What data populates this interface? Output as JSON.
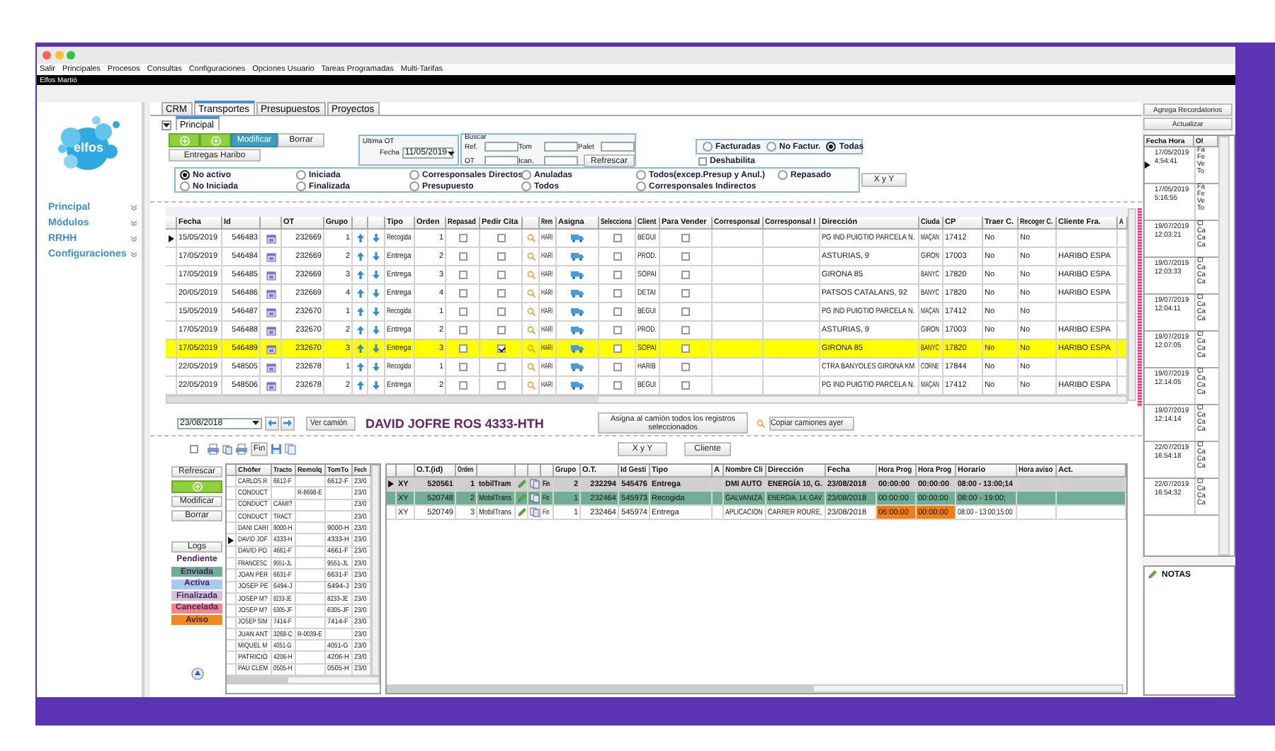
{
  "menu": [
    "Salir",
    "Principales",
    "Procesos",
    "Consultas",
    "Configuraciones",
    "Opciones Usuario",
    "Tareas Programadas",
    "Multi-Tarifas"
  ],
  "company": "Elfos Martió",
  "sidebar": {
    "logo": "elfos",
    "items": [
      {
        "label": "Principal"
      },
      {
        "label": "Módulos"
      },
      {
        "label": "RRHH"
      },
      {
        "label": "Configuraciones"
      }
    ]
  },
  "tabs": [
    {
      "label": "CRM",
      "selected": false
    },
    {
      "label": "Transportes",
      "selected": true
    },
    {
      "label": "Presupuestos",
      "selected": false
    },
    {
      "label": "Proyectos",
      "selected": false
    }
  ],
  "subtabs": [
    {
      "label": "Principal",
      "selected": true
    }
  ],
  "actions": [
    {
      "kind": "add"
    },
    {
      "kind": "add"
    },
    {
      "kind": "primary",
      "label": "Modificar"
    },
    {
      "kind": "plain",
      "label": "Borrar"
    }
  ],
  "secondary_action": "Entregas Haribo",
  "last_ot": {
    "title": "Ultima OT",
    "date_label": "Fecha",
    "date": "11/05/2019"
  },
  "search": {
    "title": "Buscar",
    "fields": [
      {
        "label": "Ref."
      },
      {
        "label": "Tom"
      },
      {
        "label": "Palet"
      },
      {
        "label": "OT"
      },
      {
        "label": "Ican."
      }
    ],
    "button": "Refrescar"
  },
  "billing_filter": [
    {
      "label": "Facturadas",
      "selected": false
    },
    {
      "label": "No Factur.",
      "selected": false
    },
    {
      "label": "Todas",
      "selected": true
    }
  ],
  "disable_checkbox": {
    "label": "Deshabilita",
    "checked": false
  },
  "state_filter": [
    {
      "label": "No activo",
      "selected": true
    },
    {
      "label": "Iniciada",
      "selected": false
    },
    {
      "label": "Corresponsales Directos",
      "selected": false
    },
    {
      "label": "Anuladas",
      "selected": false
    },
    {
      "label": "Todos(excep.Presup y Anul.)",
      "selected": false
    },
    {
      "label": "Repasado",
      "selected": false
    },
    {
      "label": "No Iniciada",
      "selected": false
    },
    {
      "label": "Finalizada",
      "selected": false
    },
    {
      "label": "Presupuesto",
      "selected": false
    },
    {
      "label": "Todos",
      "selected": false
    },
    {
      "label": "Corresponsales Indirectos",
      "selected": false
    }
  ],
  "xy_button": "X y Y",
  "orders": {
    "columns": [
      "Fecha",
      "Id",
      "OT",
      "Grupo",
      "Tipo",
      "Orden",
      "Repasad",
      "Pedir Cita",
      "Rem",
      "Asigna",
      "Selecciona",
      "Client",
      "Para Vender",
      "Corresponsal",
      "Corresponsal I",
      "Dirección",
      "Ciuda",
      "CP",
      "Traer C.",
      "Recoger C.",
      "Cliente Fra.",
      "A"
    ],
    "rows": [
      {
        "fecha": "15/05/2019",
        "id": "546483",
        "ot": "232669",
        "grupo": "1",
        "tipo": "Recogida",
        "orden": "1",
        "repasado": false,
        "pedir_cita": false,
        "rem": "HARI",
        "seleccion": false,
        "cliente": "BEGUI",
        "para_vender": false,
        "direccion": "PG IND PUIGTIO PARCELA N.",
        "ciudad": "MAÇAN",
        "cp": "17412",
        "traer": "No",
        "recoger": "No",
        "cliente_fra": "",
        "current": true,
        "selected": false
      },
      {
        "fecha": "17/05/2019",
        "id": "546484",
        "ot": "232669",
        "grupo": "2",
        "tipo": "Entrega",
        "orden": "2",
        "repasado": false,
        "pedir_cita": false,
        "rem": "HARI",
        "seleccion": false,
        "cliente": "PROD.",
        "para_vender": false,
        "direccion": "ASTURIAS, 9",
        "ciudad": "GIRON",
        "cp": "17003",
        "traer": "No",
        "recoger": "No",
        "cliente_fra": "HARIBO ESPA",
        "current": false,
        "selected": false
      },
      {
        "fecha": "17/05/2019",
        "id": "546485",
        "ot": "232669",
        "grupo": "3",
        "tipo": "Entrega",
        "orden": "3",
        "repasado": false,
        "pedir_cita": false,
        "rem": "HARI",
        "seleccion": false,
        "cliente": "SOPAI",
        "para_vender": false,
        "direccion": "GIRONA 85",
        "ciudad": "BANYC",
        "cp": "17820",
        "traer": "No",
        "recoger": "No",
        "cliente_fra": "HARIBO ESPA",
        "current": false,
        "selected": false
      },
      {
        "fecha": "20/05/2019",
        "id": "546486",
        "ot": "232669",
        "grupo": "4",
        "tipo": "Entrega",
        "orden": "4",
        "repasado": false,
        "pedir_cita": false,
        "rem": "HARI",
        "seleccion": false,
        "cliente": "DETAI",
        "para_vender": false,
        "direccion": "PATSOS CATALANS, 92",
        "ciudad": "BANYC",
        "cp": "17820",
        "traer": "No",
        "recoger": "No",
        "cliente_fra": "HARIBO ESPA",
        "current": false,
        "selected": false
      },
      {
        "fecha": "15/05/2019",
        "id": "546487",
        "ot": "232670",
        "grupo": "1",
        "tipo": "Recogida",
        "orden": "1",
        "repasado": false,
        "pedir_cita": false,
        "rem": "HARI",
        "seleccion": false,
        "cliente": "BEGUI",
        "para_vender": false,
        "direccion": "PG IND PUIGTIO PARCELA N.",
        "ciudad": "MAÇAN",
        "cp": "17412",
        "traer": "No",
        "recoger": "No",
        "cliente_fra": "",
        "current": false,
        "selected": false
      },
      {
        "fecha": "17/05/2019",
        "id": "546488",
        "ot": "232670",
        "grupo": "2",
        "tipo": "Entrega",
        "orden": "2",
        "repasado": false,
        "pedir_cita": false,
        "rem": "HARI",
        "seleccion": false,
        "cliente": "PROD.",
        "para_vender": false,
        "direccion": "ASTURIAS, 9",
        "ciudad": "GIRON",
        "cp": "17003",
        "traer": "No",
        "recoger": "No",
        "cliente_fra": "HARIBO ESPA",
        "current": false,
        "selected": false
      },
      {
        "fecha": "17/05/2019",
        "id": "546489",
        "ot": "232670",
        "grupo": "3",
        "tipo": "Entrega",
        "orden": "3",
        "repasado": false,
        "pedir_cita": true,
        "rem": "HARI",
        "seleccion": false,
        "cliente": "SOPAI",
        "para_vender": false,
        "direccion": "GIRONA 85",
        "ciudad": "BANYC",
        "cp": "17820",
        "traer": "No",
        "recoger": "No",
        "cliente_fra": "HARIBO ESPA",
        "current": false,
        "selected": true
      },
      {
        "fecha": "22/05/2019",
        "id": "548505",
        "ot": "232678",
        "grupo": "1",
        "tipo": "Recogida",
        "orden": "1",
        "repasado": false,
        "pedir_cita": false,
        "rem": "HARI",
        "seleccion": false,
        "cliente": "HARIB",
        "para_vender": false,
        "direccion": "CTRA BANYOLES GIRONA KM",
        "ciudad": "CORNE",
        "cp": "17844",
        "traer": "No",
        "recoger": "No",
        "cliente_fra": "",
        "current": false,
        "selected": false
      },
      {
        "fecha": "22/05/2019",
        "id": "548506",
        "ot": "232678",
        "grupo": "2",
        "tipo": "Entrega",
        "orden": "2",
        "repasado": false,
        "pedir_cita": false,
        "rem": "HARI",
        "seleccion": false,
        "cliente": "BEGUI",
        "para_vender": false,
        "direccion": "PG IND PUIGTIO PARCELA N.",
        "ciudad": "MAÇAN",
        "cp": "17412",
        "traer": "No",
        "recoger": "No",
        "cliente_fra": "HARIBO ESPA",
        "current": false,
        "selected": false
      }
    ]
  },
  "truck_bar": {
    "date": "23/08/2018",
    "view_button": "Ver camión",
    "truck_name": "DAVID JOFRE ROS 4333-HTH",
    "assign_button": "Asigna al camión todos los registros seleccionados",
    "copy_button": "Copiar camiones ayer"
  },
  "toolbar": {
    "select_all": {
      "checked": false
    },
    "finish_button": "Fin",
    "xy_button": "X y Y",
    "client_button": "Cliente"
  },
  "side_buttons": [
    {
      "kind": "text",
      "label": "Refrescar"
    },
    {
      "kind": "add"
    },
    {
      "kind": "text",
      "label": "Modificar"
    },
    {
      "kind": "text",
      "label": "Borrar"
    }
  ],
  "logs_button": "Logs",
  "legend": [
    {
      "label": "Pendiente",
      "color": "#ffffff"
    },
    {
      "label": "Enviada",
      "color": "#6fae94"
    },
    {
      "label": "Activa",
      "color": "#a9c9f0"
    },
    {
      "label": "Finalizada",
      "color": "#cfc6dc"
    },
    {
      "label": "Cancelada",
      "color": "#f0868a"
    },
    {
      "label": "Aviso",
      "color": "#f2891e"
    }
  ],
  "drivers": {
    "columns": [
      "Chófer",
      "Tracto",
      "Remolq",
      "TomTo",
      "Fech"
    ],
    "rows": [
      {
        "chofer": "CARLOS R",
        "tractor": "6612-F",
        "remolque": "",
        "tomtom": "6612-F",
        "fecha": "23/0",
        "current": false
      },
      {
        "chofer": "CONDUCT",
        "tractor": "",
        "remolque": "R-8698-E",
        "tomtom": "",
        "fecha": "23/0",
        "current": false
      },
      {
        "chofer": "CONDUCT",
        "tractor": "CAMI?",
        "remolque": "",
        "tomtom": "",
        "fecha": "23/0",
        "current": false
      },
      {
        "chofer": "CONDUCT",
        "tractor": "TRACT",
        "remolque": "",
        "tomtom": "",
        "fecha": "23/0",
        "current": false
      },
      {
        "chofer": "DANI CARI",
        "tractor": "9000-H",
        "remolque": "",
        "tomtom": "9000-H",
        "fecha": "23/0",
        "current": false
      },
      {
        "chofer": "DAVID JOF",
        "tractor": "4333-H",
        "remolque": "",
        "tomtom": "4333-H",
        "fecha": "23/0",
        "current": true
      },
      {
        "chofer": "DAVID PO",
        "tractor": "4661-F",
        "remolque": "",
        "tomtom": "4661-F",
        "fecha": "23/0",
        "current": false
      },
      {
        "chofer": "FRANCESC",
        "tractor": "9551-JL",
        "remolque": "",
        "tomtom": "9551-JL",
        "fecha": "23/0",
        "current": false
      },
      {
        "chofer": "JOAN PER",
        "tractor": "6631-F",
        "remolque": "",
        "tomtom": "6631-F",
        "fecha": "23/0",
        "current": false
      },
      {
        "chofer": "JOSEP PE",
        "tractor": "6494-J",
        "remolque": "",
        "tomtom": "6494-J",
        "fecha": "23/0",
        "current": false
      },
      {
        "chofer": "JOSEP M?",
        "tractor": "8233-JE",
        "remolque": "",
        "tomtom": "8233-JE",
        "fecha": "23/0",
        "current": false
      },
      {
        "chofer": "JOSEP M?",
        "tractor": "6305-JF",
        "remolque": "",
        "tomtom": "6305-JF",
        "fecha": "23/0",
        "current": false
      },
      {
        "chofer": "JOSEP SIM",
        "tractor": "7414-F",
        "remolque": "",
        "tomtom": "7414-F",
        "fecha": "23/0",
        "current": false
      },
      {
        "chofer": "JUAN ANT",
        "tractor": "3268-C",
        "remolque": "R-0039-E",
        "tomtom": "",
        "fecha": "23/0",
        "current": false
      },
      {
        "chofer": "MIQUEL M",
        "tractor": "4051-G",
        "remolque": "",
        "tomtom": "4051-G",
        "fecha": "23/0",
        "current": false
      },
      {
        "chofer": "PATRICIO",
        "tractor": "4206-H",
        "remolque": "",
        "tomtom": "4206-H",
        "fecha": "23/0",
        "current": false
      },
      {
        "chofer": "PAU CLEM",
        "tractor": "0505-H",
        "remolque": "",
        "tomtom": "0505-H",
        "fecha": "23/0",
        "current": false
      }
    ]
  },
  "assignments": {
    "columns": [
      "O.T.(id)",
      "Orden",
      "Grupo",
      "O.T.",
      "Id Gesti",
      "Tipo",
      "A",
      "Nombre Cli",
      "Dirección",
      "Fecha",
      "Hora Prog",
      "Hora Prog",
      "Horario",
      "Hora aviso",
      "Act."
    ],
    "rows": [
      {
        "xy": "XY",
        "ot_id": "520561",
        "orden": "1",
        "medio": "tobilTram",
        "fin": "Fin",
        "grupo": "2",
        "ot": "232294",
        "id_gestion": "545476",
        "tipo": "Entrega",
        "nombre": "DMI AUTO",
        "direccion": "ENERGÍA 10, G.",
        "fecha": "23/08/2018",
        "hora_1": "00:00:00",
        "hora_2": "00:00:00",
        "horario": "08:00 - 13:00;14",
        "selected": true,
        "alert": false
      },
      {
        "xy": "XY",
        "ot_id": "520748",
        "orden": "2",
        "medio": "MobilTrans",
        "fin": "Fin",
        "grupo": "1",
        "ot": "232464",
        "id_gestion": "545973",
        "tipo": "Recogida",
        "nombre": "GALVANIZA",
        "direccion": "ENERGIA, 14, GAV",
        "fecha": "23/08/2018",
        "hora_1": "00:00:00",
        "hora_2": "00:00:00",
        "horario": "08:00 - 19:00;",
        "selected": false,
        "color": "#6fae94",
        "alert": false
      },
      {
        "xy": "XY",
        "ot_id": "520749",
        "orden": "3",
        "medio": "MobilTrans",
        "fin": "Fin",
        "grupo": "1",
        "ot": "232464",
        "id_gestion": "545974",
        "tipo": "Entrega",
        "nombre": "APLICACION",
        "direccion": "CARRER ROURE,",
        "fecha": "23/08/2018",
        "hora_1": "06:00:00",
        "hora_2": "00:00:00",
        "horario": "08:00 - 13:00;15:00",
        "selected": false,
        "color": "#ffffff",
        "alert": true
      }
    ]
  },
  "reminders": {
    "add_button": "Agrega Recordatorios",
    "refresh_button": "Actualizar",
    "columns": [
      "Fecha Hora",
      "Ol"
    ],
    "items": [
      {
        "date": "17/05/2019",
        "time": "4:54:41",
        "note": [
          "Fa",
          "Fe",
          "Ve",
          "To"
        ],
        "current": true
      },
      {
        "date": "17/05/2019",
        "time": "5:16:55",
        "note": [
          "Fa",
          "Fe",
          "Ve",
          "To"
        ],
        "current": false
      },
      {
        "date": "19/07/2019",
        "time": "12:03:21",
        "note": [
          "Cl",
          "Ca",
          "Ca",
          "Ca"
        ],
        "current": false
      },
      {
        "date": "19/07/2019",
        "time": "12:03:33",
        "note": [
          "Cl",
          "Ca",
          "Ca",
          "Ca"
        ],
        "current": false
      },
      {
        "date": "19/07/2019",
        "time": "12:04:11",
        "note": [
          "Cl",
          "Ca",
          "Ca",
          "Ca"
        ],
        "current": false
      },
      {
        "date": "19/07/2019",
        "time": "12:07:05",
        "note": [
          "Cl",
          "Ca",
          "Ca",
          "Ca"
        ],
        "current": false
      },
      {
        "date": "19/07/2019",
        "time": "12:14:05",
        "note": [
          "Cl",
          "Ca",
          "Ca",
          "Ca"
        ],
        "current": false
      },
      {
        "date": "19/07/2019",
        "time": "12:14:14",
        "note": [
          "Cl",
          "Ca",
          "Ca",
          "Ca"
        ],
        "current": false
      },
      {
        "date": "22/07/2019",
        "time": "16:54:18",
        "note": [
          "Cl",
          "Ca",
          "Ca",
          "Ca"
        ],
        "current": false
      },
      {
        "date": "22/07/2019",
        "time": "16:54:32",
        "note": [
          "Cl",
          "Ca",
          "Ca",
          "Ca"
        ],
        "current": false
      }
    ],
    "notes_title": "NOTAS"
  }
}
